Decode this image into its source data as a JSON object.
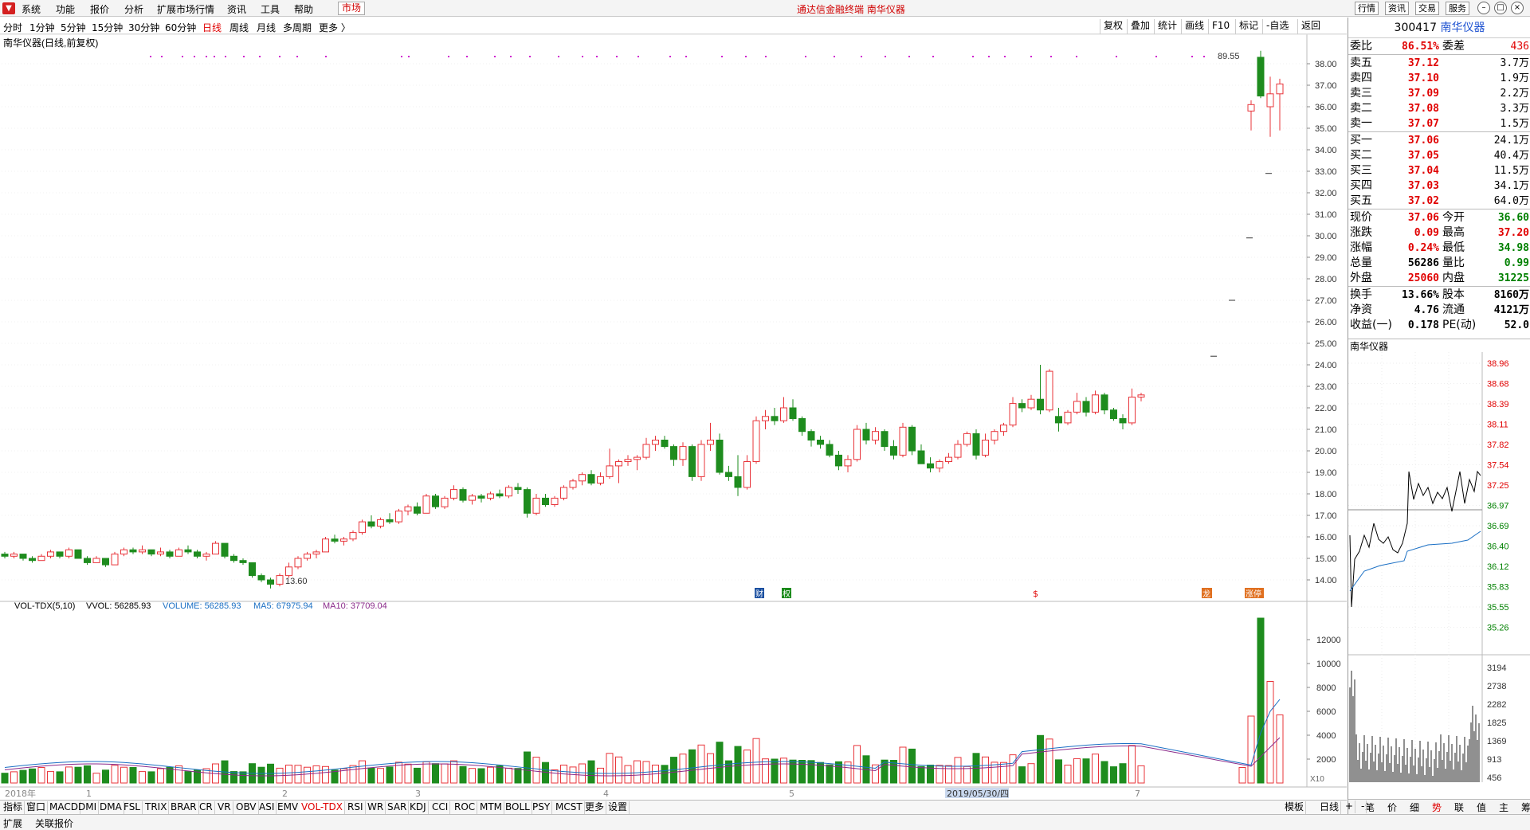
{
  "menubar": {
    "items": [
      "系统",
      "功能",
      "报价",
      "分析",
      "扩展市场行情",
      "资讯",
      "工具",
      "帮助"
    ],
    "market_tab": "市场",
    "center_title": "通达信金融终端  南华仪器",
    "right_buttons": [
      "行情",
      "资讯",
      "交易",
      "服务"
    ]
  },
  "periods": [
    "分时",
    "1分钟",
    "5分钟",
    "15分钟",
    "30分钟",
    "60分钟",
    "日线",
    "周线",
    "月线",
    "多周期",
    "更多 〉"
  ],
  "active_period": "日线",
  "tools": [
    "复权",
    "叠加",
    "统计",
    "画线",
    "F10",
    "标记",
    "-自选",
    "返回"
  ],
  "chart_title": "南华仪器(日线,前复权)",
  "price_axis": [
    "38.00",
    "37.00",
    "36.00",
    "35.00",
    "34.00",
    "33.00",
    "32.00",
    "31.00",
    "30.00",
    "29.00",
    "28.00",
    "27.00",
    "26.00",
    "25.00",
    "24.00",
    "23.00",
    "22.00",
    "21.00",
    "20.00",
    "19.00",
    "18.00",
    "17.00",
    "16.00",
    "15.00",
    "14.00"
  ],
  "annot_high": "89.55",
  "annot_low": "13.60",
  "event_markers": [
    "财",
    "权",
    "$",
    "龙",
    "涨停"
  ],
  "vol_header": {
    "name": "VOL-TDX(5,10)",
    "vvol": "VVOL: 56285.93",
    "volume": "VOLUME: 56285.93",
    "ma5": "MA5: 67975.94",
    "ma10": "MA10: 37709.04"
  },
  "vol_axis": [
    "12000",
    "10000",
    "8000",
    "6000",
    "4000",
    "2000"
  ],
  "vol_unit": "X10",
  "time_axis": [
    "2018年",
    "1",
    "2",
    "3",
    "4",
    "5",
    "2019/05/30/四",
    "7"
  ],
  "bottom_tabs": [
    "指标",
    "窗口",
    "MACD",
    "DMI",
    "DMA",
    "FSL",
    "TRIX",
    "BRAR",
    "CR",
    "VR",
    "OBV",
    "ASI",
    "EMV",
    "VOL-TDX",
    "RSI",
    "WR",
    "SAR",
    "KDJ",
    "CCI",
    "ROC",
    "MTM",
    "BOLL",
    "PSY",
    "MCST",
    "更多",
    "设置"
  ],
  "active_bottom_tab": "VOL-TDX",
  "bottom_right": [
    "模板",
    "日线",
    "+",
    "-"
  ],
  "status": [
    "扩展",
    "关联报价"
  ],
  "quote": {
    "code": "300417",
    "name": "南华仪器",
    "weibi_label": "委比",
    "weibi": "86.51%",
    "weicha_label": "委差",
    "weicha": "436",
    "sell": [
      {
        "label": "卖五",
        "price": "37.12",
        "vol": "3.7万"
      },
      {
        "label": "卖四",
        "price": "37.10",
        "vol": "1.9万"
      },
      {
        "label": "卖三",
        "price": "37.09",
        "vol": "2.2万"
      },
      {
        "label": "卖二",
        "price": "37.08",
        "vol": "3.3万"
      },
      {
        "label": "卖一",
        "price": "37.07",
        "vol": "1.5万"
      }
    ],
    "buy": [
      {
        "label": "买一",
        "price": "37.06",
        "vol": "24.1万"
      },
      {
        "label": "买二",
        "price": "37.05",
        "vol": "40.4万"
      },
      {
        "label": "买三",
        "price": "37.04",
        "vol": "11.5万"
      },
      {
        "label": "买四",
        "price": "37.03",
        "vol": "34.1万"
      },
      {
        "label": "买五",
        "price": "37.02",
        "vol": "64.0万"
      }
    ],
    "stats": [
      {
        "l1": "现价",
        "v1": "37.06",
        "c1": "red",
        "l2": "今开",
        "v2": "36.60",
        "c2": "green"
      },
      {
        "l1": "涨跌",
        "v1": "0.09",
        "c1": "red",
        "l2": "最高",
        "v2": "37.20",
        "c2": "red"
      },
      {
        "l1": "涨幅",
        "v1": "0.24%",
        "c1": "red",
        "l2": "最低",
        "v2": "34.98",
        "c2": "green"
      },
      {
        "l1": "总量",
        "v1": "56286",
        "c1": "",
        "l2": "量比",
        "v2": "0.99",
        "c2": "green"
      },
      {
        "l1": "外盘",
        "v1": "25060",
        "c1": "red",
        "l2": "内盘",
        "v2": "31225",
        "c2": "green"
      }
    ],
    "stats2": [
      {
        "l1": "换手",
        "v1": "13.66%",
        "l2": "股本",
        "v2": "8160万"
      },
      {
        "l1": "净资",
        "v1": "4.76",
        "l2": "流通",
        "v2": "4121万"
      },
      {
        "l1": "收益(一)",
        "v1": "0.178",
        "l2": "PE(动)",
        "v2": "52.0"
      }
    ]
  },
  "mini_chart": {
    "title": "南华仪器",
    "price_ticks": [
      "38.96",
      "38.68",
      "38.39",
      "38.11",
      "37.82",
      "37.54",
      "37.25",
      "36.97",
      "36.69",
      "36.40",
      "36.12",
      "35.83",
      "35.55",
      "35.26"
    ],
    "vol_ticks": [
      "3194",
      "2738",
      "2282",
      "1825",
      "1369",
      "913",
      "456"
    ]
  },
  "mini_tabs": [
    "笔",
    "价",
    "细",
    "势",
    "联",
    "值",
    "主",
    "筹"
  ],
  "active_mini_tab": "势",
  "chart_data": {
    "type": "candlestick",
    "ylim": [
      13,
      39
    ],
    "candles": [
      [
        15.2,
        15.3,
        15.0,
        15.1
      ],
      [
        15.1,
        15.3,
        15.0,
        15.2
      ],
      [
        15.2,
        15.2,
        14.9,
        15.0
      ],
      [
        15.0,
        15.1,
        14.8,
        14.9
      ],
      [
        14.9,
        15.2,
        14.9,
        15.1
      ],
      [
        15.1,
        15.4,
        15.0,
        15.3
      ],
      [
        15.3,
        15.3,
        15.0,
        15.1
      ],
      [
        15.1,
        15.5,
        15.0,
        15.4
      ],
      [
        15.4,
        15.4,
        15.0,
        15.0
      ],
      [
        15.0,
        15.1,
        14.7,
        14.8
      ],
      [
        14.8,
        15.1,
        14.8,
        15.0
      ],
      [
        15.0,
        15.0,
        14.6,
        14.7
      ],
      [
        14.7,
        15.3,
        14.7,
        15.2
      ],
      [
        15.2,
        15.5,
        15.1,
        15.4
      ],
      [
        15.4,
        15.5,
        15.2,
        15.3
      ],
      [
        15.3,
        15.6,
        15.2,
        15.4
      ],
      [
        15.4,
        15.4,
        15.1,
        15.2
      ],
      [
        15.2,
        15.5,
        15.1,
        15.3
      ],
      [
        15.3,
        15.4,
        15.0,
        15.1
      ],
      [
        15.1,
        15.5,
        15.1,
        15.4
      ],
      [
        15.4,
        15.6,
        15.2,
        15.3
      ],
      [
        15.3,
        15.4,
        15.0,
        15.1
      ],
      [
        15.1,
        15.3,
        14.9,
        15.2
      ],
      [
        15.2,
        15.8,
        15.2,
        15.7
      ],
      [
        15.7,
        15.7,
        15.0,
        15.1
      ],
      [
        15.1,
        15.2,
        14.8,
        14.9
      ],
      [
        14.9,
        15.0,
        14.7,
        14.8
      ],
      [
        14.8,
        14.8,
        14.1,
        14.2
      ],
      [
        14.2,
        14.3,
        13.9,
        14.0
      ],
      [
        14.0,
        14.1,
        13.6,
        13.8
      ],
      [
        13.8,
        14.3,
        13.7,
        14.2
      ],
      [
        14.2,
        14.8,
        14.1,
        14.6
      ],
      [
        14.6,
        15.1,
        14.5,
        15.0
      ],
      [
        15.0,
        15.3,
        14.9,
        15.2
      ],
      [
        15.2,
        15.4,
        15.0,
        15.3
      ],
      [
        15.3,
        16.0,
        15.3,
        15.9
      ],
      [
        15.9,
        16.1,
        15.7,
        15.8
      ],
      [
        15.8,
        16.0,
        15.6,
        15.9
      ],
      [
        15.9,
        16.3,
        15.8,
        16.2
      ],
      [
        16.2,
        16.8,
        16.1,
        16.7
      ],
      [
        16.7,
        17.0,
        16.4,
        16.5
      ],
      [
        16.5,
        16.9,
        16.4,
        16.8
      ],
      [
        16.8,
        17.1,
        16.6,
        16.7
      ],
      [
        16.7,
        17.3,
        16.6,
        17.2
      ],
      [
        17.2,
        17.5,
        17.0,
        17.4
      ],
      [
        17.4,
        17.6,
        17.0,
        17.1
      ],
      [
        17.1,
        18.0,
        17.1,
        17.9
      ],
      [
        17.9,
        18.0,
        17.3,
        17.4
      ],
      [
        17.4,
        17.9,
        17.3,
        17.8
      ],
      [
        17.8,
        18.4,
        17.7,
        18.2
      ],
      [
        18.2,
        18.3,
        17.6,
        17.7
      ],
      [
        17.7,
        18.0,
        17.5,
        17.9
      ],
      [
        17.9,
        18.0,
        17.6,
        17.8
      ],
      [
        17.8,
        18.1,
        17.7,
        18.0
      ],
      [
        18.0,
        18.2,
        17.8,
        17.9
      ],
      [
        17.9,
        18.4,
        17.8,
        18.3
      ],
      [
        18.3,
        18.5,
        18.0,
        18.2
      ],
      [
        18.2,
        18.3,
        16.9,
        17.1
      ],
      [
        17.1,
        18.0,
        17.0,
        17.8
      ],
      [
        17.8,
        18.0,
        17.4,
        17.5
      ],
      [
        17.5,
        17.9,
        17.4,
        17.8
      ],
      [
        17.8,
        18.4,
        17.7,
        18.3
      ],
      [
        18.3,
        18.7,
        18.2,
        18.6
      ],
      [
        18.6,
        19.0,
        18.4,
        18.9
      ],
      [
        18.9,
        19.1,
        18.4,
        18.5
      ],
      [
        18.5,
        19.0,
        18.4,
        18.8
      ],
      [
        18.8,
        20.1,
        18.7,
        19.3
      ],
      [
        19.3,
        19.6,
        18.5,
        19.5
      ],
      [
        19.5,
        19.8,
        19.3,
        19.6
      ],
      [
        19.6,
        19.8,
        19.1,
        19.7
      ],
      [
        19.7,
        20.6,
        19.6,
        20.3
      ],
      [
        20.3,
        20.7,
        20.0,
        20.5
      ],
      [
        20.5,
        20.7,
        20.1,
        20.2
      ],
      [
        20.2,
        20.3,
        19.3,
        19.6
      ],
      [
        19.6,
        20.4,
        19.3,
        20.2
      ],
      [
        20.2,
        20.3,
        18.6,
        18.8
      ],
      [
        18.8,
        20.5,
        18.6,
        20.3
      ],
      [
        20.3,
        21.3,
        20.0,
        20.5
      ],
      [
        20.5,
        20.8,
        18.9,
        19.0
      ],
      [
        19.0,
        19.3,
        18.6,
        18.8
      ],
      [
        18.8,
        19.8,
        17.9,
        18.3
      ],
      [
        18.3,
        19.8,
        18.2,
        19.5
      ],
      [
        19.5,
        21.6,
        19.4,
        21.4
      ],
      [
        21.4,
        21.9,
        21.0,
        21.6
      ],
      [
        21.6,
        22.0,
        21.2,
        21.4
      ],
      [
        21.4,
        22.5,
        21.3,
        22.0
      ],
      [
        22.0,
        22.4,
        21.4,
        21.5
      ],
      [
        21.5,
        21.6,
        20.7,
        20.9
      ],
      [
        20.9,
        21.0,
        20.2,
        20.5
      ],
      [
        20.5,
        20.7,
        20.1,
        20.3
      ],
      [
        20.3,
        20.5,
        19.7,
        19.8
      ],
      [
        19.8,
        20.0,
        19.1,
        19.3
      ],
      [
        19.3,
        19.8,
        19.0,
        19.6
      ],
      [
        19.6,
        21.2,
        19.5,
        21.0
      ],
      [
        21.0,
        21.3,
        20.3,
        20.5
      ],
      [
        20.5,
        21.1,
        20.3,
        20.9
      ],
      [
        20.9,
        21.0,
        20.0,
        20.2
      ],
      [
        20.2,
        20.5,
        19.6,
        19.8
      ],
      [
        19.8,
        21.3,
        19.7,
        21.1
      ],
      [
        21.1,
        21.2,
        19.8,
        20.0
      ],
      [
        20.0,
        20.3,
        19.6,
        19.4
      ],
      [
        19.4,
        19.7,
        19.0,
        19.2
      ],
      [
        19.2,
        19.6,
        19.0,
        19.5
      ],
      [
        19.5,
        19.9,
        19.4,
        19.7
      ],
      [
        19.7,
        20.5,
        19.6,
        20.3
      ],
      [
        20.3,
        20.9,
        20.2,
        20.8
      ],
      [
        20.8,
        21.0,
        19.6,
        19.8
      ],
      [
        19.8,
        20.8,
        19.7,
        20.5
      ],
      [
        20.5,
        21.0,
        20.3,
        20.9
      ],
      [
        20.9,
        21.3,
        20.7,
        21.2
      ],
      [
        21.2,
        22.5,
        21.1,
        22.2
      ],
      [
        22.2,
        22.4,
        21.8,
        22.0
      ],
      [
        22.0,
        22.6,
        21.9,
        22.4
      ],
      [
        22.4,
        24.0,
        21.7,
        21.9
      ],
      [
        21.9,
        23.8,
        21.8,
        23.7
      ],
      [
        21.6,
        22.0,
        20.9,
        21.3
      ],
      [
        21.3,
        21.9,
        21.2,
        21.8
      ],
      [
        21.8,
        22.7,
        21.7,
        22.3
      ],
      [
        22.3,
        22.5,
        21.6,
        21.8
      ],
      [
        21.8,
        22.8,
        21.7,
        22.6
      ],
      [
        22.6,
        22.7,
        21.7,
        21.9
      ],
      [
        21.9,
        22.0,
        21.4,
        21.5
      ],
      [
        21.5,
        21.7,
        21.0,
        21.3
      ],
      [
        21.3,
        22.9,
        21.2,
        22.5
      ],
      [
        22.5,
        22.7,
        22.3,
        22.6
      ]
    ],
    "gap_candles": [
      [
        24.4,
        24.4,
        24.4,
        24.4
      ],
      [
        27.0,
        27.0,
        27.0,
        27.0
      ],
      [
        29.9,
        29.9,
        29.9,
        29.9
      ],
      [
        32.9,
        32.9,
        32.9,
        32.9
      ]
    ],
    "tail_candles": [
      [
        35.8,
        36.3,
        34.9,
        36.1
      ],
      [
        38.3,
        38.6,
        36.4,
        36.5
      ],
      [
        36.0,
        37.4,
        34.6,
        36.6
      ],
      [
        36.6,
        37.3,
        34.9,
        37.06
      ]
    ]
  }
}
